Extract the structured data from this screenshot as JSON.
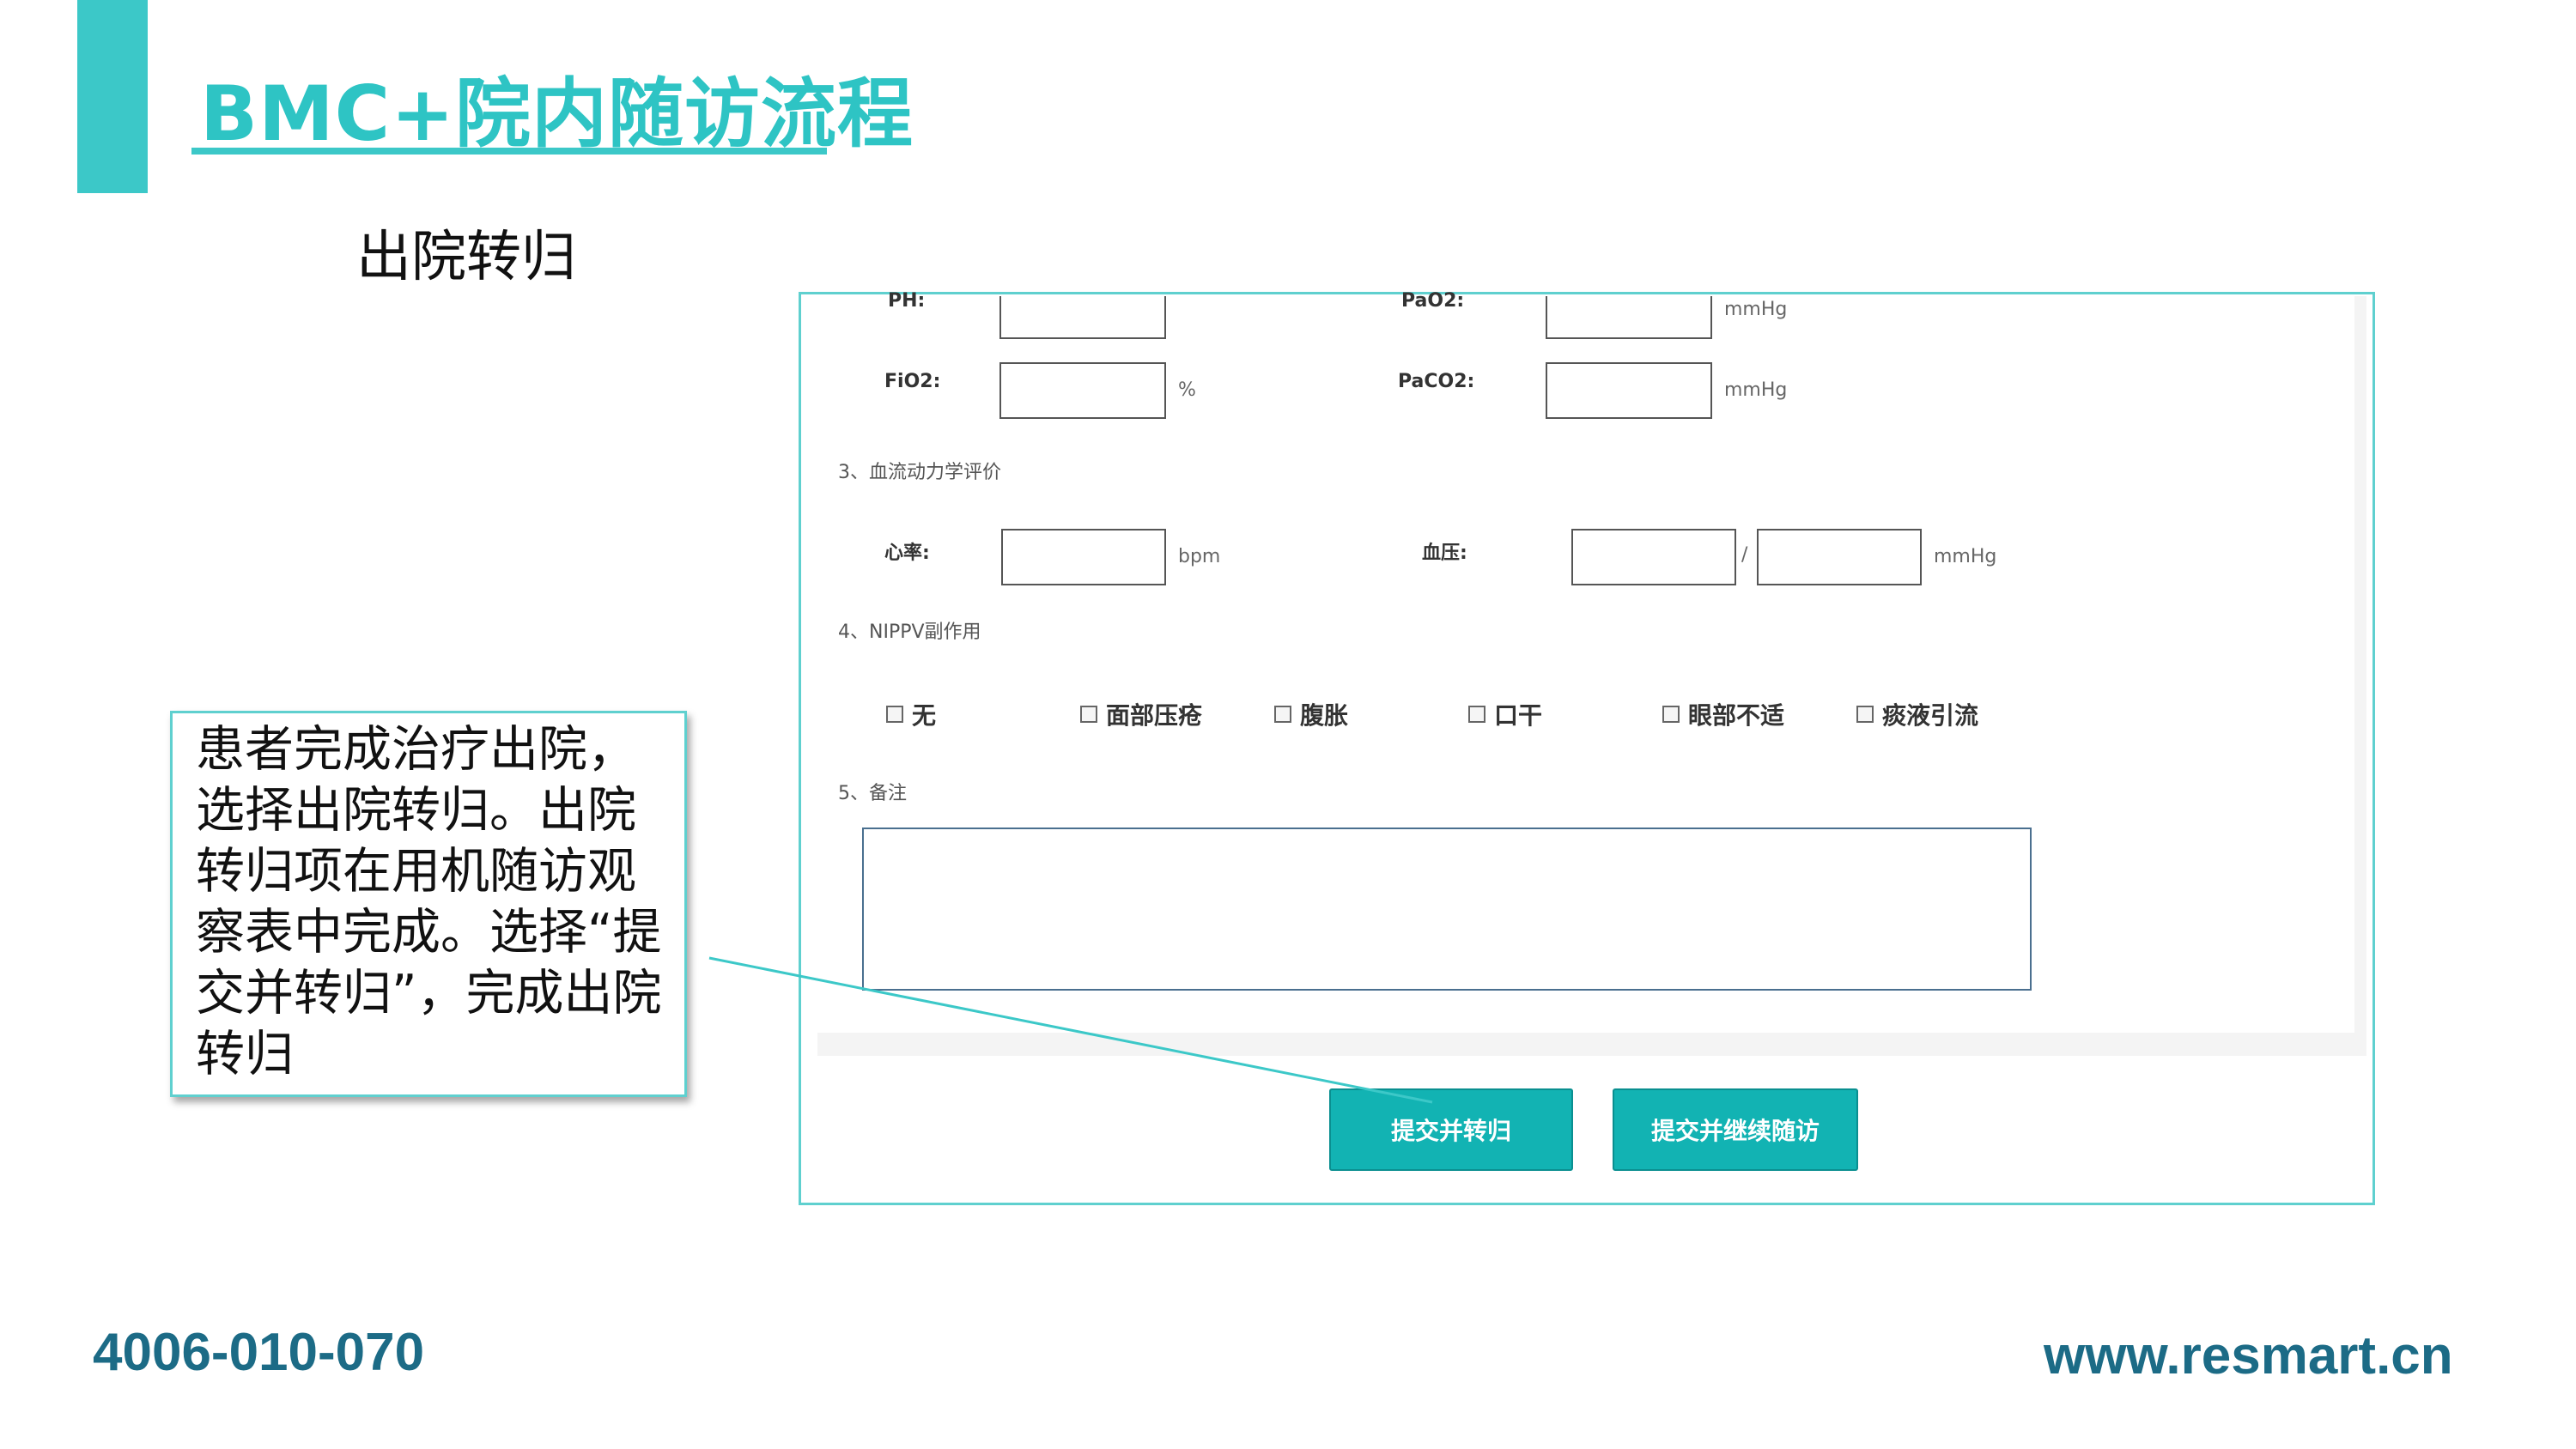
{
  "slide": {
    "title": "BMC+院内随访流程",
    "subtitle": "出院转归",
    "callout": "患者完成治疗出院，选择出院转归。出院转归项在用机随访观察表中完成。选择“提交并转归”，完成出院转归",
    "phone": "4006-010-070",
    "website": "www.resmart.cn"
  },
  "form": {
    "ph_label": "PH:",
    "pao2_label": "PaO2:",
    "pao2_unit": "mmHg",
    "fio2_label": "FiO2:",
    "fio2_unit": "%",
    "paco2_label": "PaCO2:",
    "paco2_unit": "mmHg",
    "section3": "3、血流动力学评价",
    "hr_label": "心率:",
    "hr_unit": "bpm",
    "bp_label": "血压:",
    "bp_sep": "/",
    "bp_unit": "mmHg",
    "section4": "4、NIPPV副作用",
    "side_effects": [
      "无",
      "面部压疮",
      "腹胀",
      "口干",
      "眼部不适",
      "痰液引流"
    ],
    "section5": "5、备注",
    "buttons": {
      "submit_transfer": "提交并转归",
      "submit_continue": "提交并继续随访"
    }
  },
  "colors": {
    "accent": "#3cc8c8",
    "title": "#2ec4c4",
    "button": "#12b3b3",
    "footer_text": "#1c6b86"
  }
}
